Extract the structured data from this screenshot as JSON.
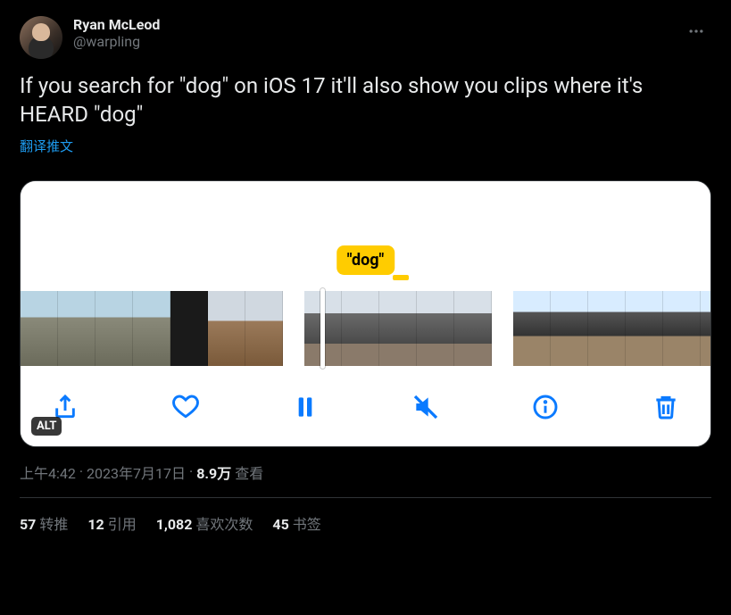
{
  "author": {
    "display_name": "Ryan McLeod",
    "handle": "@warpling"
  },
  "tweet_text": "If you search for \"dog\" on iOS 17 it'll also show you clips where it's HEARD \"dog\"",
  "translate_label": "翻译推文",
  "media": {
    "badge_text": "\"dog\"",
    "alt_label": "ALT",
    "toolbar_icons": [
      "share",
      "heart",
      "pause",
      "mute",
      "info",
      "trash"
    ]
  },
  "meta": {
    "time": "上午4:42",
    "dot1": " · ",
    "date": "2023年7月17日",
    "dot2": " · ",
    "views_num": "8.9万",
    "views_label": " 查看"
  },
  "stats": {
    "retweets_num": "57",
    "retweets_label": "转推",
    "quotes_num": "12",
    "quotes_label": "引用",
    "likes_num": "1,082",
    "likes_label": "喜欢次数",
    "bookmarks_num": "45",
    "bookmarks_label": "书签"
  }
}
